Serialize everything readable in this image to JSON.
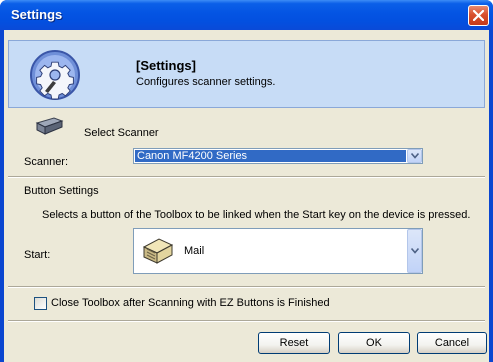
{
  "window": {
    "title": "Settings"
  },
  "header": {
    "title": "[Settings]",
    "description": "Configures scanner settings."
  },
  "scanner_section": {
    "heading": "Select Scanner",
    "scanner_label": "Scanner:",
    "scanner_value": "Canon MF4200 Series"
  },
  "button_section": {
    "heading": "Button Settings",
    "description": "Selects a button of the Toolbox to be linked when the Start key on the device is pressed.",
    "start_label": "Start:",
    "start_value": "Mail"
  },
  "options": {
    "close_toolbox_label": "Close Toolbox after Scanning with EZ Buttons is Finished",
    "close_toolbox_checked": false
  },
  "buttons": {
    "reset": "Reset",
    "ok": "OK",
    "cancel": "Cancel"
  },
  "icons": {
    "header": "settings-gear-icon",
    "scanner": "scanner-icon",
    "start": "mail-icon",
    "close": "close-icon",
    "dropdown": "chevron-down-icon"
  },
  "colors": {
    "titlebar": "#0454e3",
    "header_band": "#c7dcf6",
    "selection": "#316ac5",
    "close_button": "#d9502e"
  }
}
